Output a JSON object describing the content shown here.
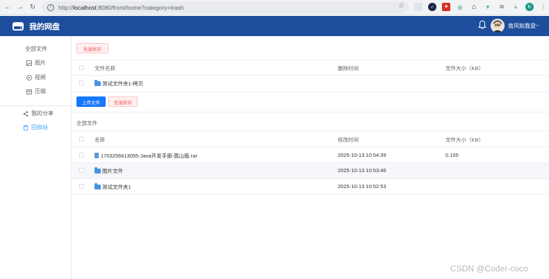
{
  "browser": {
    "url_prefix": "http://",
    "url_host": "localhost",
    "url_rest": ":8080/front/home?category=trash"
  },
  "header": {
    "app_title": "我的网盘",
    "user_name": "南风知我意",
    "caret": "⌵"
  },
  "sidebar": {
    "items": [
      {
        "label": "全部文件",
        "icon": "none"
      },
      {
        "label": "图片",
        "icon": "image-icon"
      },
      {
        "label": "视频",
        "icon": "play-icon"
      },
      {
        "label": "压缩",
        "icon": "archive-icon"
      },
      {
        "label": "我的分享",
        "icon": "share-icon"
      },
      {
        "label": "回收站",
        "icon": "trash-icon"
      }
    ],
    "active_color": "#409eff"
  },
  "trash_panel": {
    "batch_delete_label": "批量删除",
    "columns": [
      "文件名称",
      "删除时间",
      "文件大小（KB）"
    ],
    "rows": [
      {
        "name": "测试文件夹1-拷贝",
        "time": "",
        "size": ""
      }
    ]
  },
  "files_panel": {
    "upload_label": "上传文件",
    "batch_delete_label": "批量删除",
    "section_title": "全部文件",
    "columns": [
      "名称",
      "修改时间",
      "文件大小（KB）"
    ],
    "rows": [
      {
        "name": "1703256613055-Java开发手册-嵩山版.rar",
        "time": "2025-10-13 10:54:39",
        "size": "0.105",
        "type": "file"
      },
      {
        "name": "图片文件",
        "time": "2025-10-13 10:53:46",
        "size": "",
        "type": "folder"
      },
      {
        "name": "测试文件夹1",
        "time": "2025-10-13 10:52:53",
        "size": "",
        "type": "folder"
      }
    ]
  },
  "watermark": "CSDN @Coder-coco",
  "colors": {
    "header_bg": "#1c4e9d",
    "primary": "#1677ff",
    "danger": "#f56c6c"
  }
}
